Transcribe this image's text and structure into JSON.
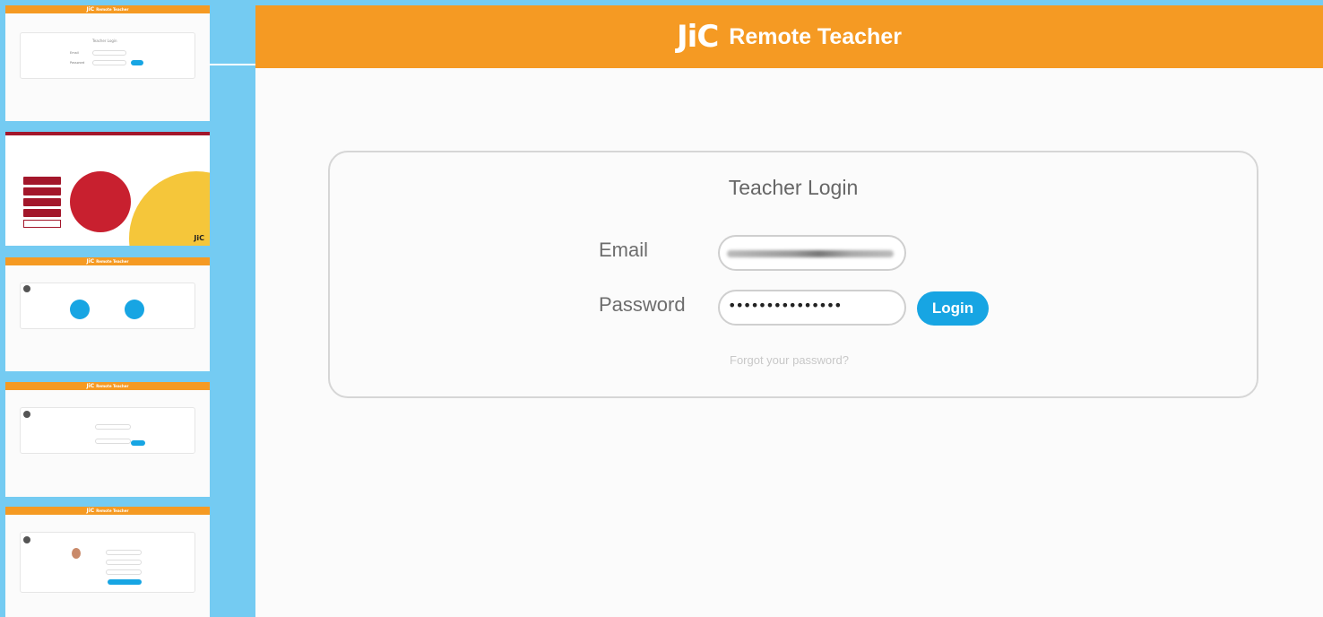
{
  "app": {
    "logo": "JiC",
    "title": "Remote Teacher"
  },
  "login": {
    "heading": "Teacher Login",
    "email_label": "Email",
    "password_label": "Password",
    "password_value": "•••••••••••••••",
    "login_button": "Login",
    "forgot_link": "Forgot your password?"
  },
  "thumbnails": {
    "t1": {
      "logo": "JiC",
      "title": "Remote Teacher",
      "heading": "Teacher Login",
      "email_label": "Email",
      "password_label": "Password"
    },
    "t2": {
      "logo": "JiC"
    },
    "t3": {
      "logo": "JiC",
      "title": "Remote Teacher"
    },
    "t4": {
      "logo": "JiC",
      "title": "Remote Teacher"
    },
    "t5": {
      "logo": "JiC",
      "title": "Remote Teacher"
    }
  },
  "colors": {
    "header_orange": "#f59a23",
    "accent_blue": "#17a5e3",
    "sidebar_blue": "#74cbf2",
    "menu_red": "#a3172b"
  }
}
